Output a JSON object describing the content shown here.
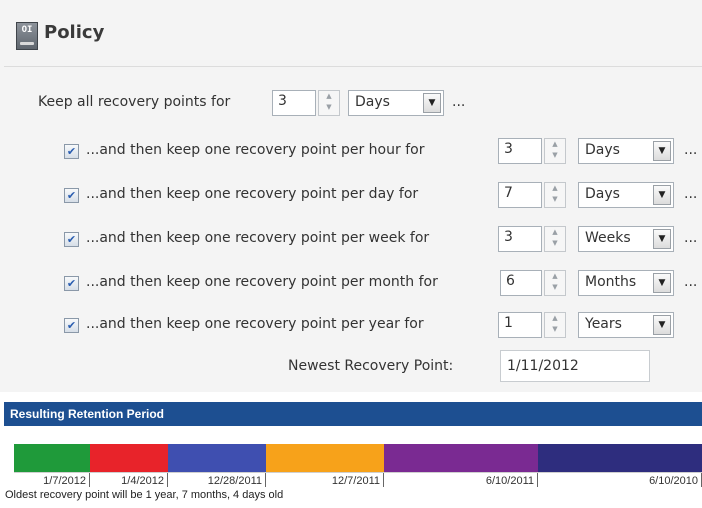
{
  "policy": {
    "icon_text": "OI",
    "title": "Policy",
    "keep_all": {
      "label": "Keep all recovery points for",
      "value": "3",
      "unit": "Days",
      "ellipsis": "..."
    },
    "rules": [
      {
        "label": "...and then keep one recovery point per hour for",
        "checked": true,
        "value": "3",
        "unit": "Days",
        "ellipsis": "..."
      },
      {
        "label": "...and then keep one recovery point per day for",
        "checked": true,
        "value": "7",
        "unit": "Days",
        "ellipsis": "..."
      },
      {
        "label": "...and then keep one recovery point per week for",
        "checked": true,
        "value": "3",
        "unit": "Weeks",
        "ellipsis": "..."
      },
      {
        "label": "...and then keep one recovery point per month for",
        "checked": true,
        "value": "6",
        "unit": "Months",
        "ellipsis": "..."
      },
      {
        "label": "...and then keep one recovery point per year for",
        "checked": true,
        "value": "1",
        "unit": "Years"
      }
    ],
    "newest_label": "Newest Recovery Point:",
    "newest_value": "1/11/2012"
  },
  "retention": {
    "title": "Resulting Retention Period",
    "segments": [
      {
        "color": "#1f9a3a"
      },
      {
        "color": "#e8232a"
      },
      {
        "color": "#3f4fb0"
      },
      {
        "color": "#f7a21a"
      },
      {
        "color": "#7a2a92"
      },
      {
        "color": "#2e2d7e"
      }
    ],
    "tick_labels": [
      "1/7/2012",
      "1/4/2012",
      "12/28/2011",
      "12/7/2011",
      "6/10/2011",
      "6/10/2010"
    ],
    "footer": "Oldest recovery point will be 1 year, 7 months, 4 days old"
  }
}
